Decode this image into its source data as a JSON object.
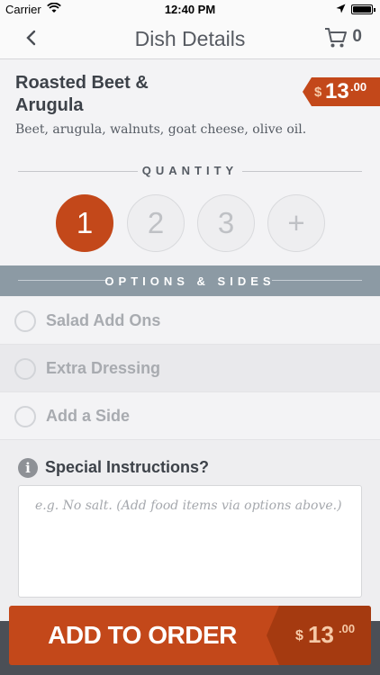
{
  "status_bar": {
    "carrier": "Carrier",
    "time": "12:40 PM"
  },
  "nav": {
    "title": "Dish Details",
    "cart_count": "0"
  },
  "dish": {
    "name": "Roasted Beet & Arugula",
    "description": "Beet, arugula, walnuts, goat cheese, olive oil.",
    "price_currency": "$",
    "price_dollars": "13",
    "price_cents": ".00"
  },
  "quantity": {
    "label": "QUANTITY",
    "options": [
      "1",
      "2",
      "3",
      "+"
    ],
    "selected": "1"
  },
  "options_sides": {
    "label": "OPTIONS & SIDES",
    "items": [
      {
        "label": "Salad Add Ons"
      },
      {
        "label": "Extra Dressing"
      },
      {
        "label": "Add a Side"
      }
    ]
  },
  "special_instructions": {
    "title": "Special Instructions?",
    "placeholder": "e.g. No salt. (Add food items via options above.)",
    "value": ""
  },
  "add_to_order": {
    "label": "ADD TO ORDER",
    "price_currency": "$",
    "price_dollars": "13",
    "price_cents": ".00"
  },
  "colors": {
    "accent": "#c3481a",
    "header_bar": "#8c9aa4",
    "text": "#3d4249"
  }
}
